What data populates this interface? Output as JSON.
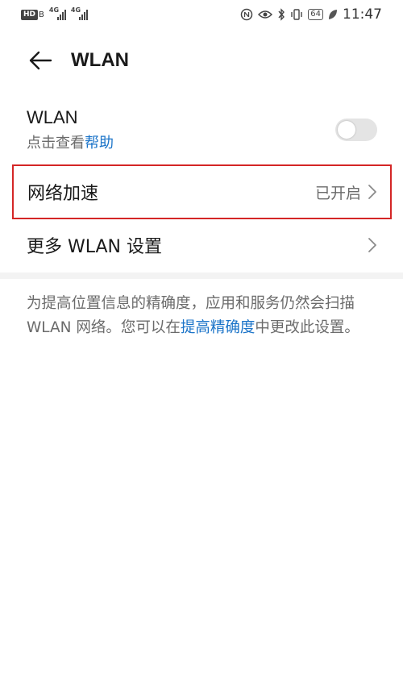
{
  "status_bar": {
    "hd_label": "HD",
    "hd_suffix": "B",
    "sim1_tag": "4G",
    "sim2_tag": "4G",
    "battery": "64",
    "time": "11:47",
    "icons": [
      "hd-icon",
      "signal-icon",
      "signal-icon",
      "nfc-icon",
      "eye-icon",
      "bluetooth-icon",
      "vibrate-icon",
      "battery-icon",
      "leaf-icon"
    ]
  },
  "header": {
    "title": "WLAN"
  },
  "wlan": {
    "title": "WLAN",
    "sub_prefix": "点击查看",
    "sub_link": "帮助",
    "toggle_on": false
  },
  "accel": {
    "label": "网络加速",
    "value": "已开启"
  },
  "more": {
    "label": "更多 WLAN 设置"
  },
  "note": {
    "prefix": "为提高位置信息的精确度，应用和服务仍然会扫描 WLAN 网络。您可以在",
    "link": "提高精确度",
    "suffix": "中更改此设置。"
  },
  "colors": {
    "link": "#1a73c8",
    "highlight_border": "#d42626",
    "toggle_off": "#e4e4e4"
  }
}
